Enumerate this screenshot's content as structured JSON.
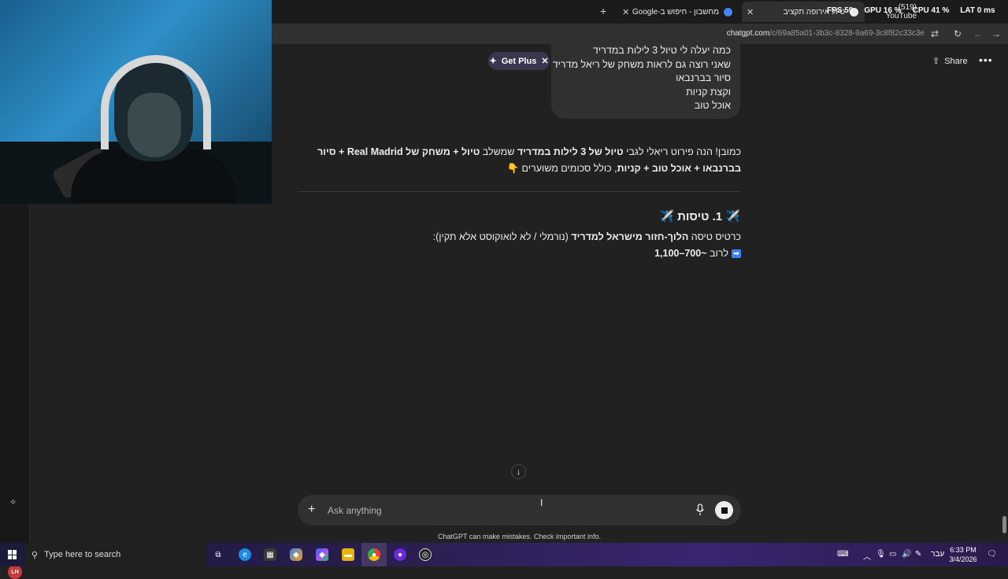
{
  "browser": {
    "tabs": [
      {
        "title": "טיול אירופה תקציב",
        "active": true
      },
      {
        "title": "מחשבון - חיפוש ב-Google",
        "active": false
      },
      {
        "title": "(519) YouTube",
        "active": false
      }
    ],
    "url_host": "chatgpt.com",
    "url_path": "/c/69a85a01-3b3c-8328-9a69-3c8f82c33c3e"
  },
  "perf_overlay": {
    "fps": "FPS 59",
    "gpu": "GPU 16 %",
    "cpu": "CPU 41 %",
    "lat": "LAT 0 ms"
  },
  "header": {
    "get_plus": "Get Plus",
    "share": "Share"
  },
  "user_message": {
    "lines": [
      "כמה יעלה לי טיול 3 לילות במדריד",
      "שאני רוצה גם לראות משחק של ריאל מדריד",
      "סיור בברנבאו",
      "וקצת קניות",
      "אוכל טוב"
    ]
  },
  "answer": {
    "intro_1": "כמובן! הנה פירוט ריאלי לגבי ",
    "intro_b1": "טיול של 3 לילות במדריד",
    "intro_2": " שמשלב ",
    "intro_b2": "טיול + משחק של Real Madrid + סיור בברנבאו + אוכל טוב + קניות",
    "intro_3": ", כולל סכומים משוערים 👇",
    "section_title": "1. טיסות",
    "flight_line_a": "כרטיס טיסה ",
    "flight_line_b": "הלוך-חזור מישראל למדריד",
    "flight_line_c": " (נורמלי / לא לואוקוסט אלא תקין):",
    "price_prefix": "לרוב ",
    "price_value": "~700–1,100"
  },
  "composer": {
    "placeholder": "Ask anything"
  },
  "disclaimer": "ChatGPT can make mistakes. Check important info.",
  "sidebar": {
    "avatar_initials": "LH"
  },
  "taskbar": {
    "search_placeholder": "Type here to search",
    "lang": "עבר",
    "time": "6:33 PM",
    "date": "3/4/2026"
  }
}
